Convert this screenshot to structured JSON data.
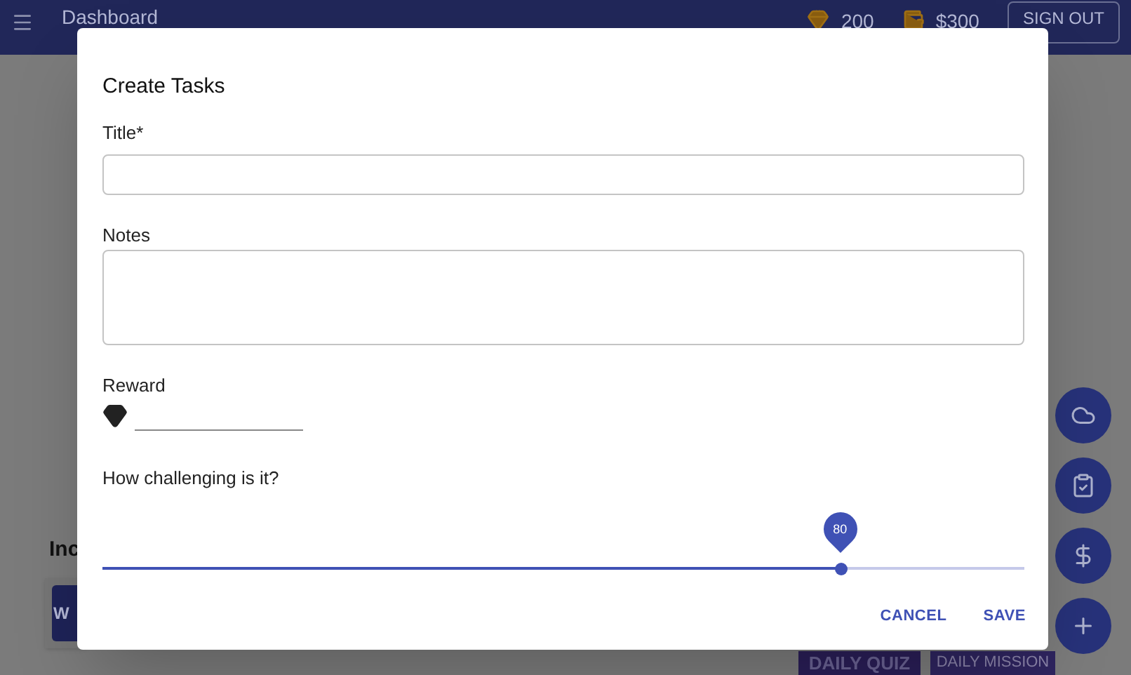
{
  "app_bar": {
    "title": "Dashboard",
    "gems": "200",
    "money": "$300",
    "sign_out": "SIGN OUT"
  },
  "background": {
    "section_title": "Inc",
    "button": "W",
    "tabs": [
      {
        "kind": "quiz",
        "label": "DAILY QUIZ"
      },
      {
        "kind": "mission",
        "label": "DAILY MISSION"
      }
    ]
  },
  "fab_buttons": [
    {
      "kind": "cloud"
    },
    {
      "kind": "task"
    },
    {
      "kind": "dollar"
    },
    {
      "kind": "add"
    }
  ],
  "dialog": {
    "title": "Create Tasks",
    "fields": [
      {
        "kind": "text",
        "label": "Title*"
      },
      {
        "kind": "multiline",
        "label": "Notes"
      },
      {
        "kind": "reward",
        "label": "Reward"
      }
    ],
    "slider": {
      "label": "How challenging is it?",
      "level": 0.8,
      "value_label": "80"
    },
    "actions": [
      "CANCEL",
      "SAVE"
    ]
  }
}
